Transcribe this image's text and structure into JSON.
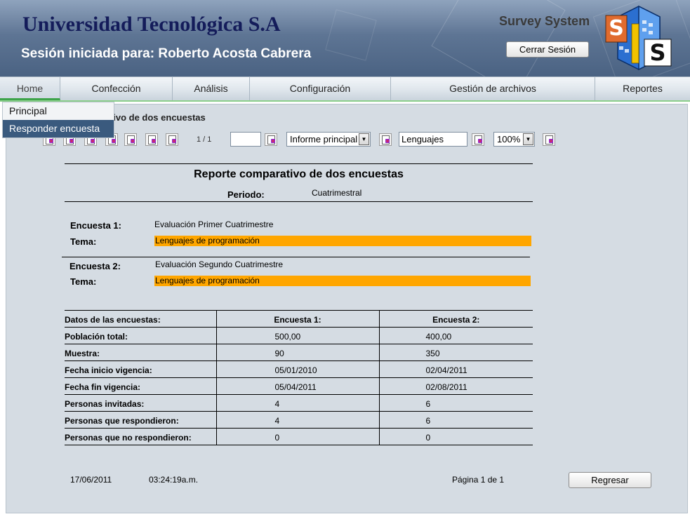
{
  "header": {
    "org_title": "Universidad Tecnológica S.A",
    "session_text": "Sesión iniciada para: Roberto Acosta Cabrera",
    "system_name": "Survey System",
    "logout_label": "Cerrar Sesión",
    "logo_label": "Survey System"
  },
  "menu": {
    "items": [
      {
        "label": "Home"
      },
      {
        "label": "Confección"
      },
      {
        "label": "Análisis"
      },
      {
        "label": "Configuración"
      },
      {
        "label": "Gestión de archivos"
      },
      {
        "label": "Reportes"
      }
    ],
    "dropdown": [
      {
        "label": "Principal"
      },
      {
        "label": "Responder encuesta"
      }
    ]
  },
  "toolbar": {
    "page_count": "1 / 1",
    "page_input": "",
    "report_select": "Informe principal",
    "search_value": "Lenguajes",
    "zoom_select": "100%"
  },
  "report": {
    "caption": "Reporte comparativo de dos encuestas",
    "title": "Reporte comparativo de dos encuestas",
    "period_label": "Periodo:",
    "period_value": "Cuatrimestral",
    "survey1_label": "Encuesta 1:",
    "survey1_value": "Evaluación Primer Cuatrimestre",
    "topic1_label": "Tema:",
    "topic1_value": "Lenguajes de programación",
    "survey2_label": "Encuesta 2:",
    "survey2_value": "Evaluación Segundo Cuatrimestre",
    "topic2_label": "Tema:",
    "topic2_value": "Lenguajes de programación",
    "highlight_color": "#ffa600",
    "table": {
      "headers": [
        "Datos de las encuestas:",
        "Encuesta 1:",
        "Encuesta 2:"
      ],
      "rows": [
        [
          "Población total:",
          "500,00",
          "400,00"
        ],
        [
          "Muestra:",
          "90",
          "350"
        ],
        [
          "Fecha inicio vigencia:",
          "05/01/2010",
          "02/04/2011"
        ],
        [
          "Fecha fin vigencia:",
          "05/04/2011",
          "02/08/2011"
        ],
        [
          "Personas invitadas:",
          "4",
          "6"
        ],
        [
          "Personas que respondieron:",
          "4",
          "6"
        ],
        [
          "Personas que no respondieron:",
          "0",
          "0"
        ]
      ]
    },
    "footer_date": "17/06/2011",
    "footer_time": "03:24:19a.m.",
    "footer_page": "Página 1 de 1"
  },
  "actions": {
    "back_label": "Regresar"
  }
}
